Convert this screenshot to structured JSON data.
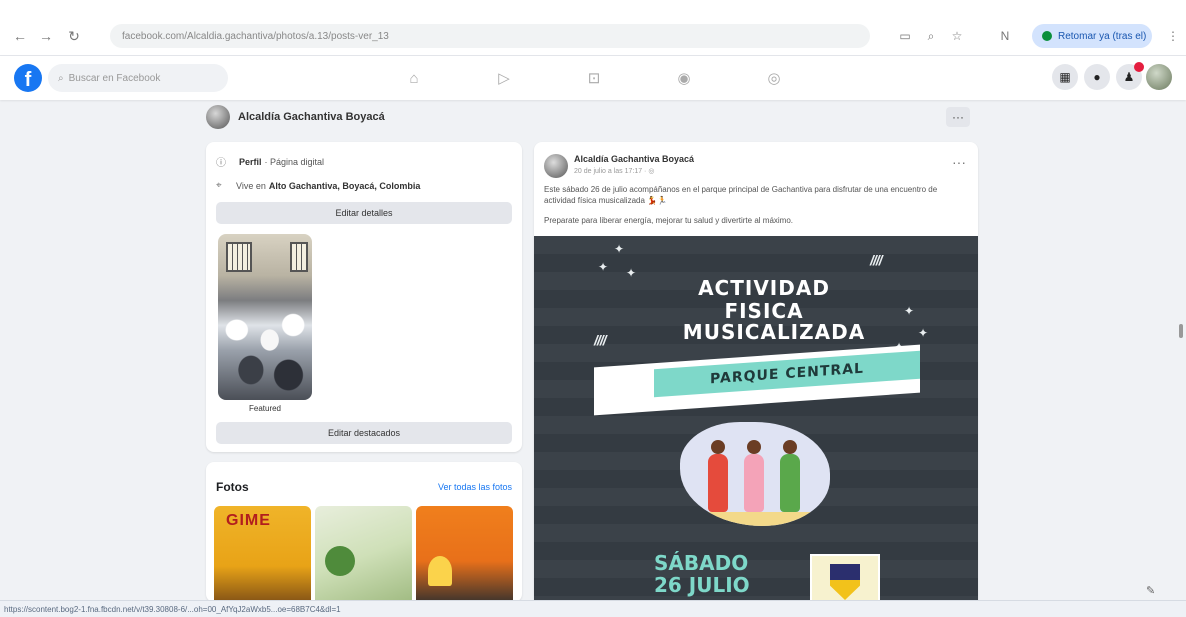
{
  "browser": {
    "back_icon": "←",
    "forward_icon": "→",
    "reload_icon": "↻",
    "url": "facebook.com/Alcaldia.gachantiva/photos/a.13/posts-ver_13",
    "resume_label": "Retomar ya (tras el)",
    "icons": [
      "screen-cast-icon",
      "zoom-icon",
      "star-icon",
      "profile-n-icon"
    ]
  },
  "fb": {
    "logo": "f",
    "search_placeholder": "Buscar en Facebook",
    "nav_icons": [
      "home-icon",
      "video-icon",
      "marketplace-icon",
      "groups-icon",
      "gaming-icon"
    ]
  },
  "profile": {
    "name": "Alcaldía Gachantiva Boyacá",
    "more_label": "···"
  },
  "intro": {
    "work_label": "Perfil",
    "work_value": "· Página digital",
    "location_prefix": "Vive en",
    "location_value": "Alto Gachantiva, Boyacá, Colombia",
    "edit_details_label": "Editar detalles",
    "featured_label": "Featured",
    "edit_featured_label": "Editar destacados"
  },
  "photos": {
    "title": "Fotos",
    "see_all": "Ver todas las fotos",
    "thumb1_text": "GIME"
  },
  "post": {
    "author": "Alcaldía Gachantiva Boyacá",
    "meta": "20 de julio a las 17:17 · ◎",
    "text": "Este sábado 26 de julio acompáñanos en el parque principal de Gachantiva para disfrutar de una encuentro de actividad física musicalizada 💃🏃",
    "text2": "Preparate para liberar energía, mejorar tu salud y divertirte al máximo.",
    "dots": "···",
    "poster": {
      "line1": "ACTIVIDAD",
      "line2": "FISICA",
      "line3": "MUSICALIZADA",
      "slashes_left": "////",
      "slashes_right": "////",
      "banner": "PARQUE CENTRAL",
      "day": "SÁBADO",
      "date": "26 JULIO"
    }
  },
  "status_url": "https://scontent.bog2-1.fna.fbcdn.net/v/t39.30808-6/...oh=00_AfYqJ2aWxb5...oe=68B7C4&dl=1",
  "colors": {
    "accent": "#1877f2",
    "poster_bg": "#3b4249",
    "poster_accent": "#7ed8c9"
  }
}
